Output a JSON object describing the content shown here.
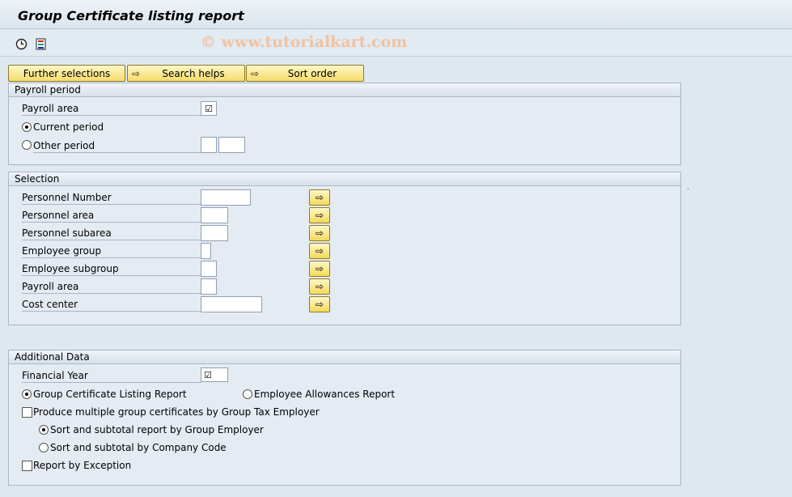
{
  "window": {
    "title": "Group Certificate listing report"
  },
  "appbar": {
    "execute_icon": "execute-clock-icon",
    "variant_icon": "selection-options-icon",
    "watermark": "© www.tutorialkart.com"
  },
  "toolbar": {
    "further_selections": "Further selections",
    "search_helps": "Search helps",
    "sort_order": "Sort order"
  },
  "payroll_period": {
    "header": "Payroll period",
    "payroll_area_label": "Payroll area",
    "current_period_label": "Current period",
    "other_period_label": "Other period",
    "current_period_selected": true
  },
  "selection": {
    "header": "Selection",
    "fields": [
      {
        "label": "Personnel Number",
        "value": ""
      },
      {
        "label": "Personnel area",
        "value": ""
      },
      {
        "label": "Personnel subarea",
        "value": ""
      },
      {
        "label": "Employee group",
        "value": ""
      },
      {
        "label": "Employee subgroup",
        "value": ""
      },
      {
        "label": "Payroll area",
        "value": ""
      },
      {
        "label": "Cost center",
        "value": ""
      }
    ]
  },
  "additional_data": {
    "header": "Additional Data",
    "financial_year_label": "Financial Year",
    "group_cert_listing_label": "Group Certificate Listing Report",
    "employee_allowances_label": "Employee Allowances Report",
    "produce_multiple_label": "Produce multiple group certificates by Group Tax Employer",
    "sort_group_employer_label": "Sort and subtotal report by Group Employer",
    "sort_company_code_label": "Sort and subtotal by Company Code",
    "report_by_exception_label": "Report by Exception"
  },
  "colors": {
    "background": "#dfe7ef",
    "button_yellow": "#f6dd6a",
    "group_border": "#a9b8c8"
  }
}
